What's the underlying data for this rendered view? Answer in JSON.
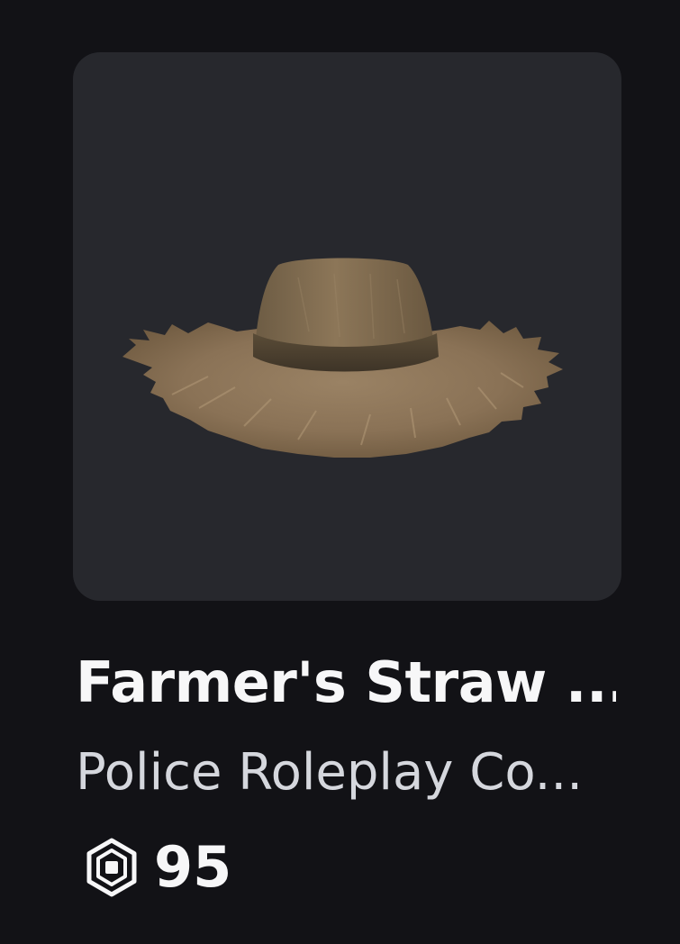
{
  "item": {
    "name": "Farmer's Straw ...",
    "creator": "Police Roleplay Co...",
    "price": "95",
    "currency_icon": "robux-icon",
    "thumbnail_icon": "straw-hat-image"
  },
  "colors": {
    "background": "#121216",
    "thumbnail_background": "#27282d",
    "title": "#f7f7f8",
    "creator": "#d5d7dd",
    "price": "#f7f7f8"
  }
}
